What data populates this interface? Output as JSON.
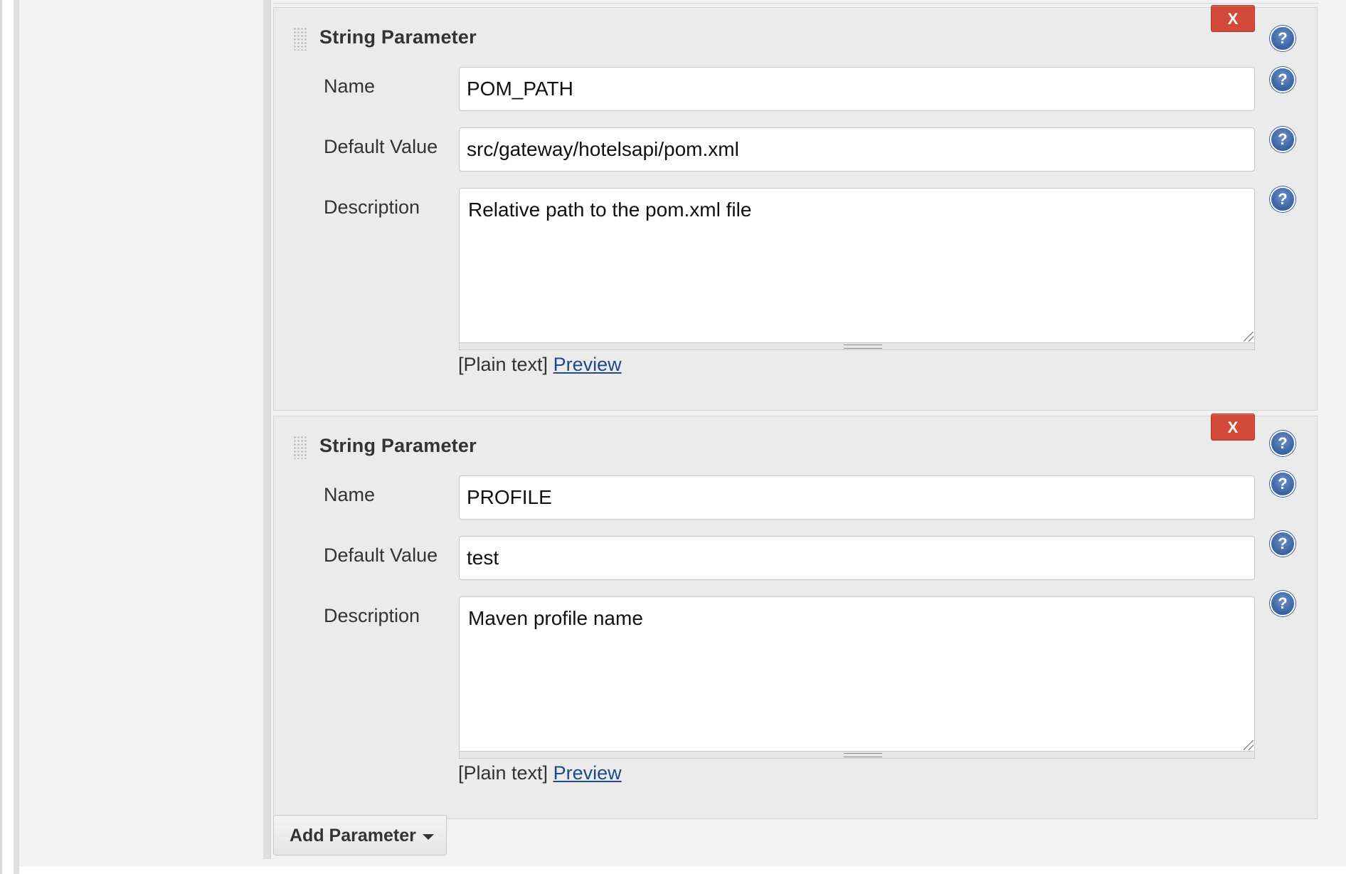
{
  "parameters": [
    {
      "type_label": "String Parameter",
      "delete_label": "X",
      "name_label": "Name",
      "name_value": "POM_PATH",
      "default_label": "Default Value",
      "default_value": "src/gateway/hotelsapi/pom.xml",
      "description_label": "Description",
      "description_value": "Relative path to the pom.xml file",
      "format_label": "[Plain text]",
      "preview_label": "Preview"
    },
    {
      "type_label": "String Parameter",
      "delete_label": "X",
      "name_label": "Name",
      "name_value": "PROFILE",
      "default_label": "Default Value",
      "default_value": "test",
      "description_label": "Description",
      "description_value": "Maven profile name",
      "format_label": "[Plain text]",
      "preview_label": "Preview"
    }
  ],
  "help_icon_glyph": "?",
  "add_parameter_label": "Add Parameter",
  "icons": {
    "help": "help-circle-icon",
    "drag": "drag-handle-icon",
    "dropdown": "caret-down-icon"
  },
  "colors": {
    "delete_button": "#d24939",
    "help_icon": "#3f68a8",
    "link": "#204a87",
    "panel_bg": "#ebebeb"
  }
}
